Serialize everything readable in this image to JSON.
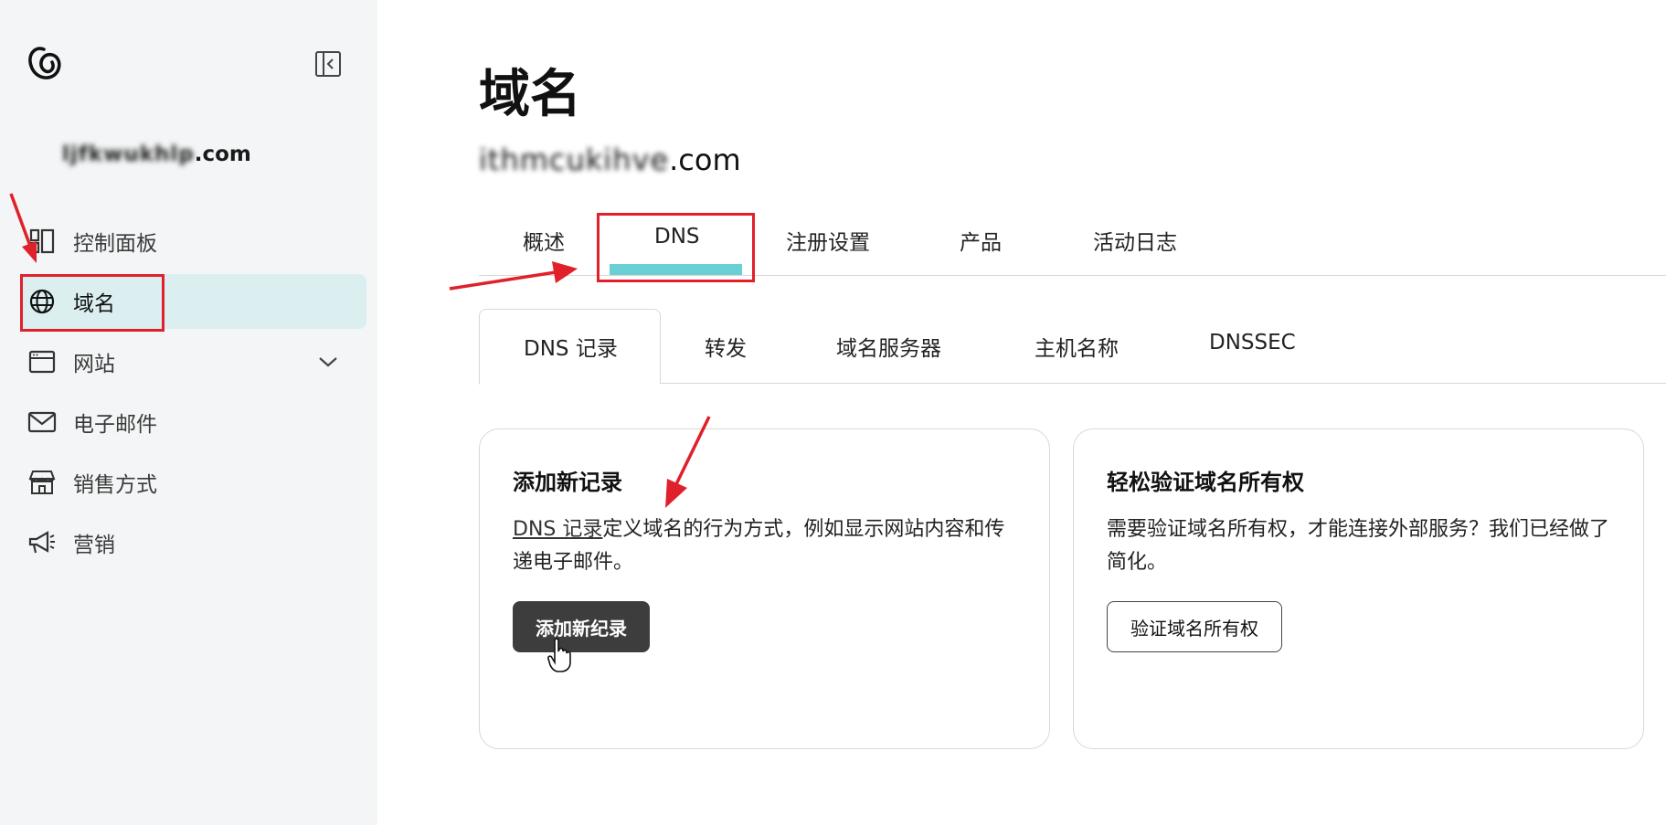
{
  "sidebar": {
    "domain_label_blurred": "ljfkwukhlp",
    "domain_label_suffix": ".com",
    "items": [
      {
        "label": "控制面板",
        "icon": "dashboard-icon"
      },
      {
        "label": "域名",
        "icon": "globe-icon",
        "active": true
      },
      {
        "label": "网站",
        "icon": "browser-window-icon",
        "has_chevron": true
      },
      {
        "label": "电子邮件",
        "icon": "mail-icon"
      },
      {
        "label": "销售方式",
        "icon": "storefront-icon"
      },
      {
        "label": "营销",
        "icon": "megaphone-icon"
      }
    ]
  },
  "main": {
    "title": "域名",
    "domain_blurred": "ithmcukihve",
    "domain_suffix": ".com",
    "tabs": [
      {
        "label": "概述"
      },
      {
        "label": "DNS",
        "active": true
      },
      {
        "label": "注册设置"
      },
      {
        "label": "产品"
      },
      {
        "label": "活动日志"
      }
    ],
    "subtabs": [
      {
        "label": "DNS 记录",
        "active": true
      },
      {
        "label": "转发"
      },
      {
        "label": "域名服务器"
      },
      {
        "label": "主机名称"
      },
      {
        "label": "DNSSEC"
      }
    ],
    "cards": {
      "add_record": {
        "title": "添加新记录",
        "link_text": "DNS 记录",
        "body_rest": "定义域名的行为方式，例如显示网站内容和传递电子邮件。",
        "button_label": "添加新纪录"
      },
      "verify": {
        "title": "轻松验证域名所有权",
        "body": "需要验证域名所有权，才能连接外部服务？我们已经做了简化。",
        "button_label": "验证域名所有权"
      }
    }
  },
  "colors": {
    "sidebar_bg": "#f4f5f6",
    "active_nav_bg": "#dbeff1",
    "tab_indicator": "#6bd0d6",
    "primary_button": "#3d3d3d",
    "annotation_red": "#e0202a"
  }
}
